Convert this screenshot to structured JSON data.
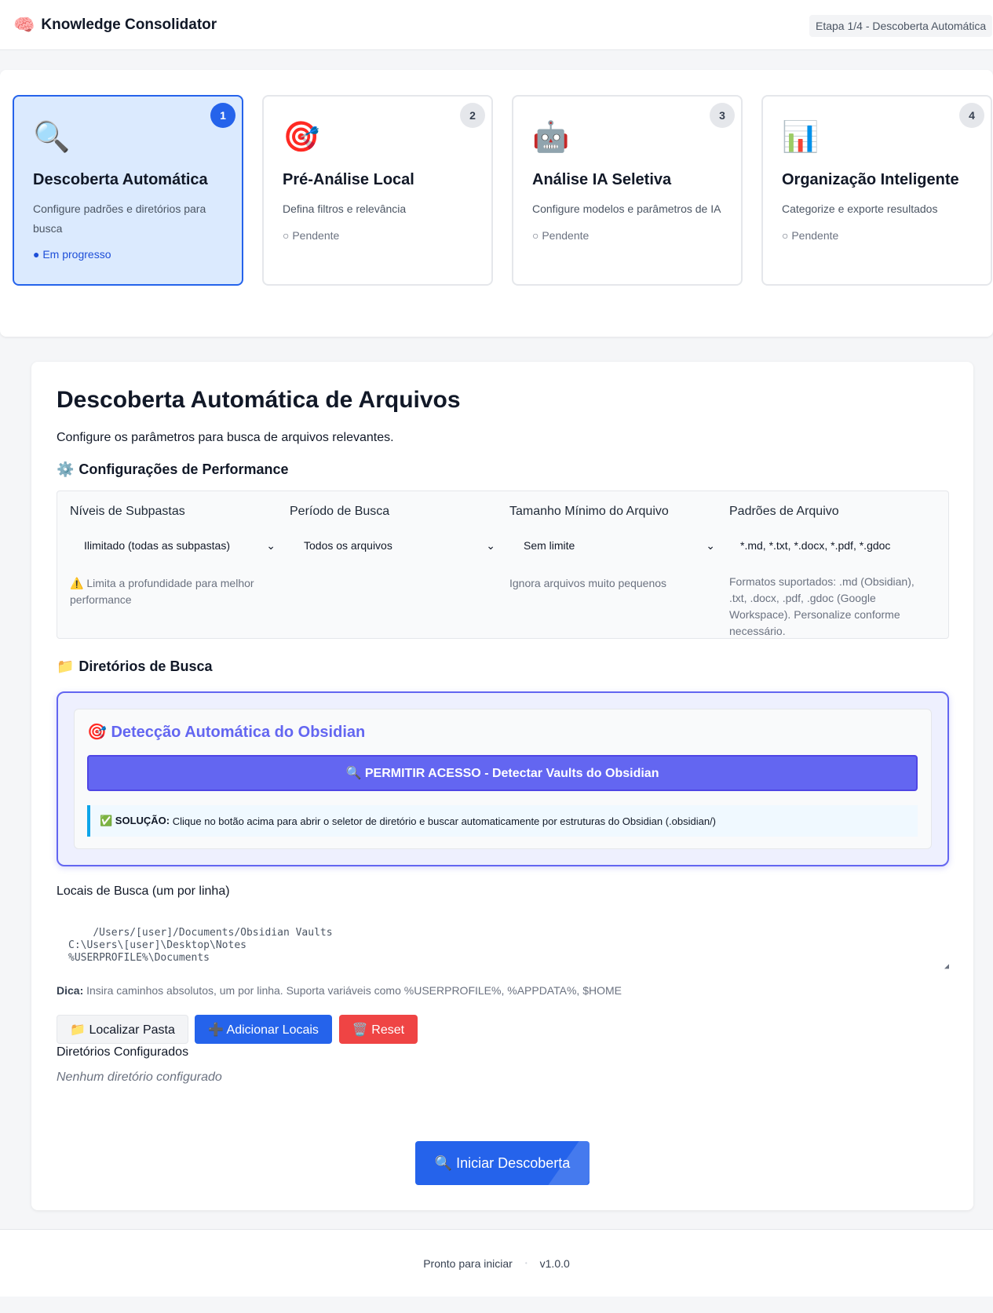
{
  "header": {
    "logo_icon": "🧠",
    "title": "Knowledge Consolidator",
    "step_badge": "Etapa 1/4 - Descoberta Automática"
  },
  "steps": [
    {
      "number": "1",
      "icon": "🔍",
      "title": "Descoberta Automática",
      "description": "Configure padrões e diretórios para busca",
      "status": "● Em progresso",
      "active": true
    },
    {
      "number": "2",
      "icon": "🎯",
      "title": "Pré-Análise Local",
      "description": "Defina filtros e relevância",
      "status": "○ Pendente",
      "active": false
    },
    {
      "number": "3",
      "icon": "🤖",
      "title": "Análise IA Seletiva",
      "description": "Configure modelos e parâmetros de IA",
      "status": "○ Pendente",
      "active": false
    },
    {
      "number": "4",
      "icon": "📊",
      "title": "Organização Inteligente",
      "description": "Categorize e exporte resultados",
      "status": "○ Pendente",
      "active": false
    }
  ],
  "main": {
    "title": "Descoberta Automática de Arquivos",
    "intro": "Configure os parâmetros para busca de arquivos relevantes.",
    "performance": {
      "icon": "⚙️",
      "heading": "Configurações de Performance",
      "fields": {
        "depth": {
          "label": "Níveis de Subpastas",
          "value": "Ilimitado (todas as subpastas)",
          "hint": "⚠️ Limita a profundidade para melhor performance"
        },
        "period": {
          "label": "Período de Busca",
          "value": "Todos os arquivos"
        },
        "min_size": {
          "label": "Tamanho Mínimo do Arquivo",
          "value": "Sem limite",
          "hint": "Ignora arquivos muito pequenos"
        },
        "patterns": {
          "label": "Padrões de Arquivo",
          "value": "*.md, *.txt, *.docx, *.pdf, *.gdoc",
          "hint": "Formatos suportados: .md (Obsidian), .txt, .docx, .pdf, .gdoc (Google Workspace). Personalize conforme necessário."
        }
      }
    },
    "directories": {
      "icon": "📁",
      "heading": "Diretórios de Busca",
      "obsidian": {
        "title": "🎯 Detecção Automática do Obsidian",
        "button": "🔍 PERMITIR ACESSO - Detectar Vaults do Obsidian",
        "note_strong": "✅ SOLUÇÃO:",
        "note_text": " Clique no botão acima para abrir o seletor de diretório e buscar automaticamente por estruturas do Obsidian (.obsidian/)"
      },
      "locations_label": "Locais de Busca (um por linha)",
      "locations_placeholder": "/Users/[user]/Documents/Obsidian Vaults\nC:\\Users\\[user]\\Desktop\\Notes\n%USERPROFILE%\\Documents",
      "tip_strong": "Dica:",
      "tip_text": " Insira caminhos absolutos, um por linha. Suporta variáveis como %USERPROFILE%, %APPDATA%, $HOME",
      "buttons": {
        "locate": "📁 Localizar Pasta",
        "add": "➕ Adicionar Locais",
        "reset": "🗑️ Reset"
      },
      "configured_label": "Diretórios Configurados",
      "configured_empty": "Nenhum diretório configurado"
    },
    "start_button": "🔍 Iniciar Descoberta"
  },
  "footer": {
    "status": "Pronto para iniciar",
    "separator": "•",
    "version": "v1.0.0"
  },
  "colors": {
    "primary": "#2563eb",
    "obsidian_accent": "#6366f1",
    "danger": "#ef4444",
    "active_step_bg": "#dbeafe"
  }
}
